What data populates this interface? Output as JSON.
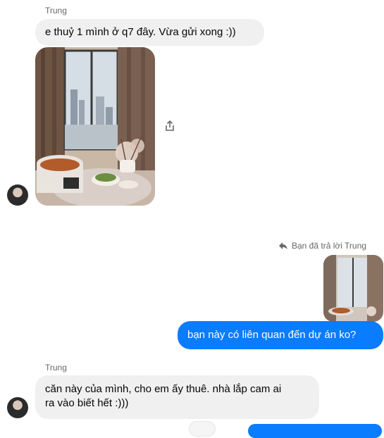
{
  "thread": {
    "msg1": {
      "sender": "Trung",
      "text": "e thuỷ 1 mình ở q7 đây. Vừa gửi xong :))"
    },
    "reply_note": "Bạn đã trả lời Trung",
    "msg_out": {
      "text": "bạn này có liên quan đến dự án ko?"
    },
    "msg2": {
      "sender": "Trung",
      "text_line1": "căn này của mình, cho em ấy thuê. nhà lắp cam ai",
      "text_line2": "ra vào biết hết :)))"
    }
  },
  "icons": {
    "share": "share-icon",
    "reply": "reply-arrow-icon"
  },
  "colors": {
    "outgoing_bubble": "#0a7cff",
    "incoming_bubble": "#f0f0f0",
    "meta_text": "#65676b"
  }
}
